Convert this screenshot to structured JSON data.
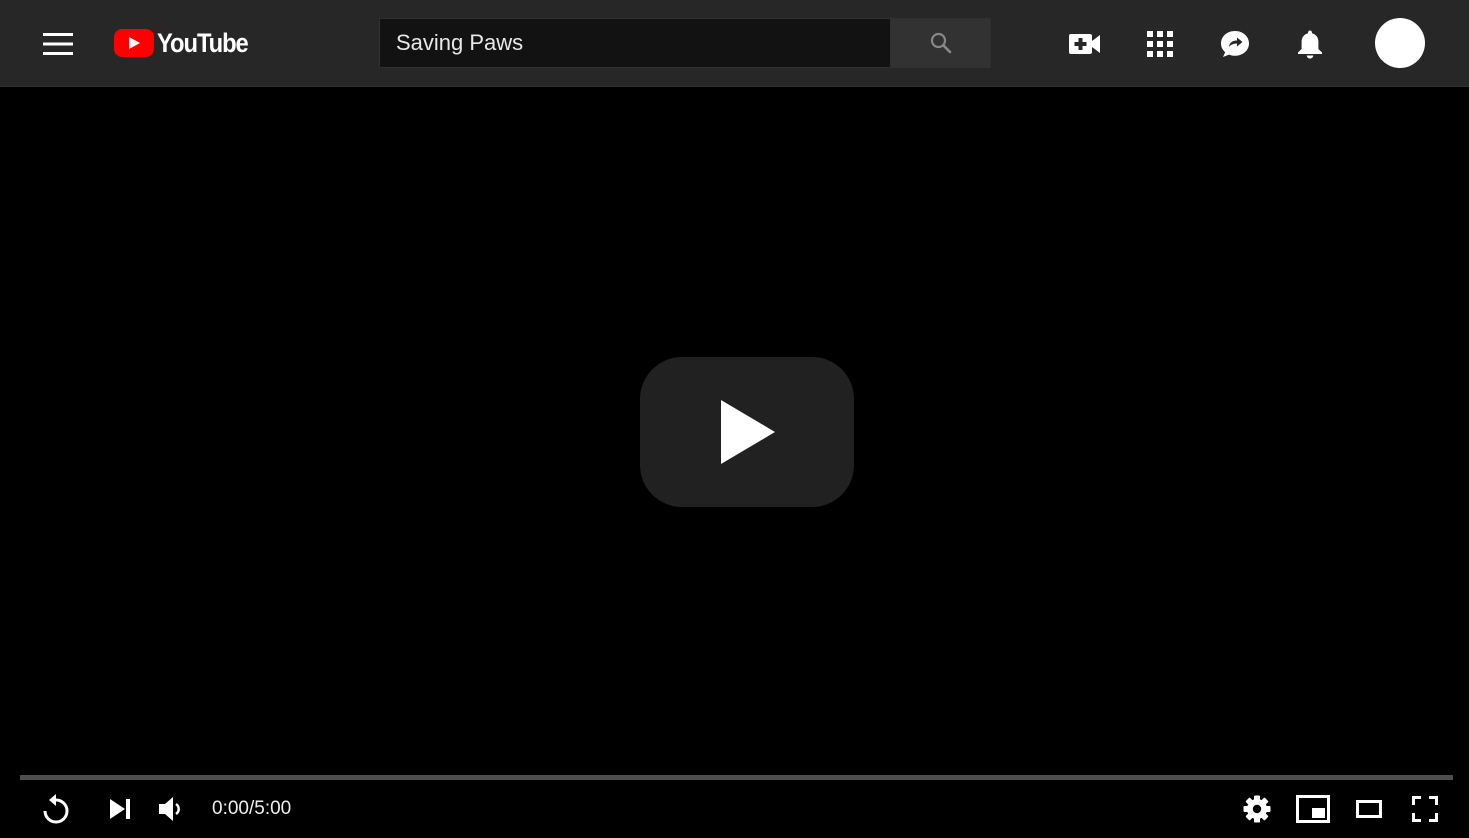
{
  "header": {
    "menu_icon": "hamburger-menu-icon",
    "logo_text": "YouTube",
    "logo_color": "#ff0000",
    "search_value": "Saving Paws",
    "search_icon": "search-icon",
    "actions": [
      {
        "name": "create-video-icon"
      },
      {
        "name": "apps-grid-icon"
      },
      {
        "name": "messages-icon"
      },
      {
        "name": "notifications-bell-icon"
      }
    ]
  },
  "player": {
    "play_icon": "play-icon",
    "progress": 0,
    "progress_color": "#ff0000",
    "time_display": "0:00/5:00",
    "controls_left": [
      "replay-icon",
      "next-icon",
      "volume-icon"
    ],
    "controls_right": [
      "settings-gear-icon",
      "miniplayer-icon",
      "theater-mode-icon",
      "fullscreen-icon"
    ]
  }
}
